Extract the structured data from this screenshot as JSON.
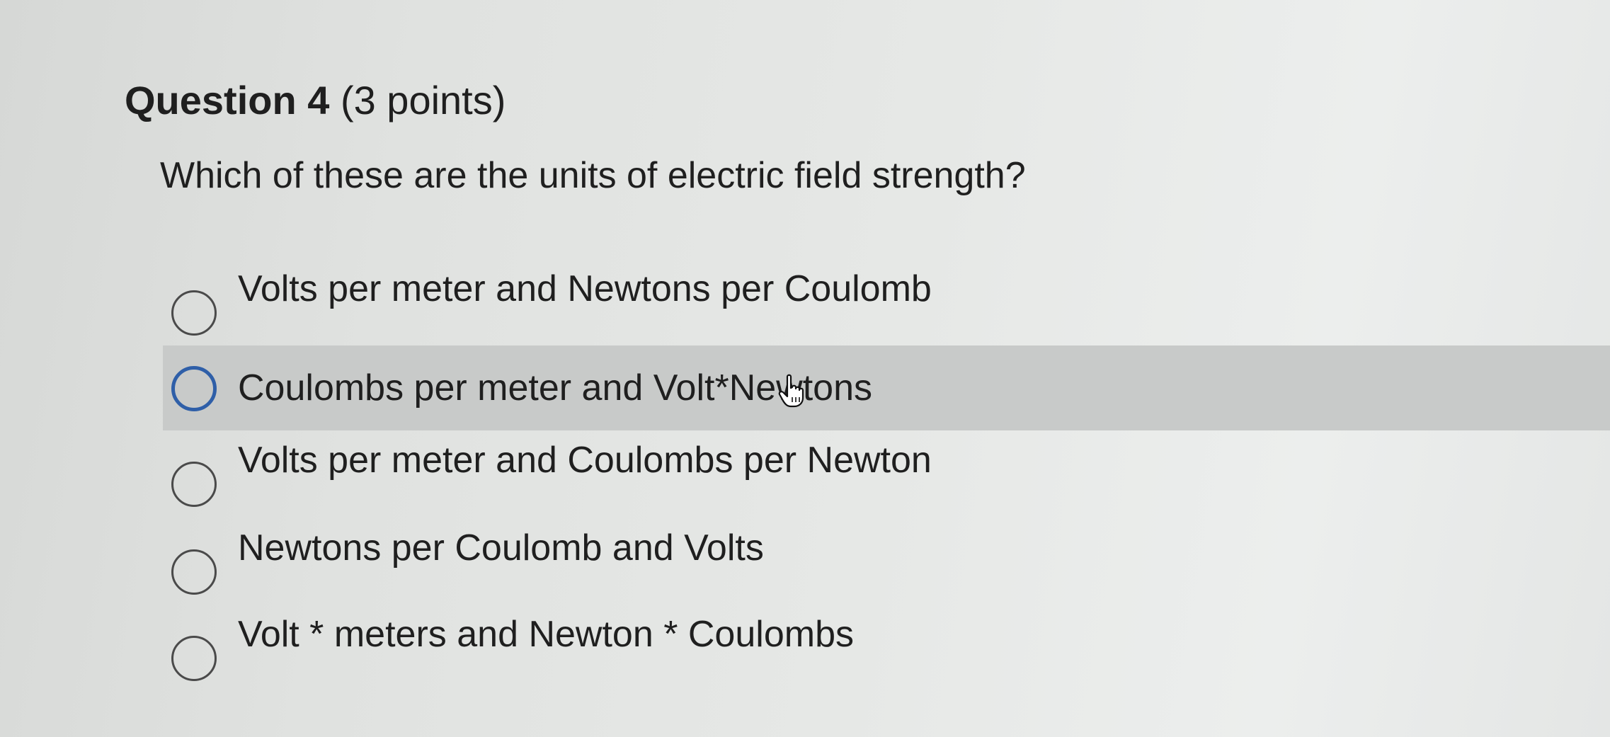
{
  "question": {
    "number_label": "Question 4",
    "points_label": "(3 points)",
    "prompt": "Which of these are the units of electric field strength?"
  },
  "options": [
    {
      "label": "Volts per meter and Newtons per Coulomb",
      "selected": false,
      "hovered": false
    },
    {
      "label": "Coulombs per meter and Volt*Newtons",
      "selected": false,
      "hovered": true
    },
    {
      "label": "Volts per meter and  Coulombs per Newton",
      "selected": false,
      "hovered": false
    },
    {
      "label": "Newtons per Coulomb and Volts",
      "selected": false,
      "hovered": false
    },
    {
      "label": "Volt * meters and Newton * Coulombs",
      "selected": false,
      "hovered": false
    }
  ],
  "cursor": {
    "icon": "hand-pointer-icon"
  },
  "colors": {
    "hover_background": "#c8cac9",
    "focus_ring": "#2f5fa8",
    "text": "#1f1f1f"
  }
}
